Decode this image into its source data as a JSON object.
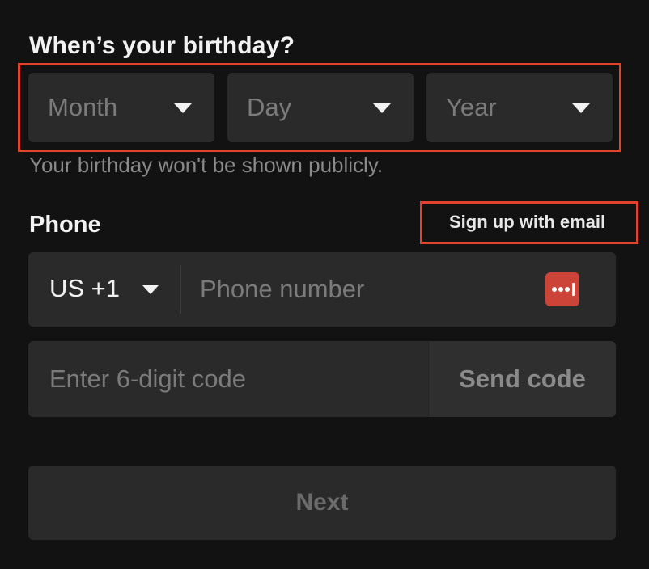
{
  "birthday": {
    "title": "When’s your birthday?",
    "month_placeholder": "Month",
    "day_placeholder": "Day",
    "year_placeholder": "Year",
    "helper_text": "Your birthday won't be shown publicly."
  },
  "phone": {
    "label": "Phone",
    "signup_email_link": "Sign up with email",
    "country_code": "US +1",
    "phone_placeholder": "Phone number",
    "code_placeholder": "Enter 6-digit code",
    "send_code_label": "Send code"
  },
  "actions": {
    "next_label": "Next"
  },
  "icons": {
    "dropdown": "chevron-down-icon",
    "password_manager": "password-manager-icon"
  },
  "colors": {
    "background": "#121212",
    "field_background": "#2a2a2a",
    "highlight_border": "#e2432c",
    "password_manager": "#cc4438"
  }
}
